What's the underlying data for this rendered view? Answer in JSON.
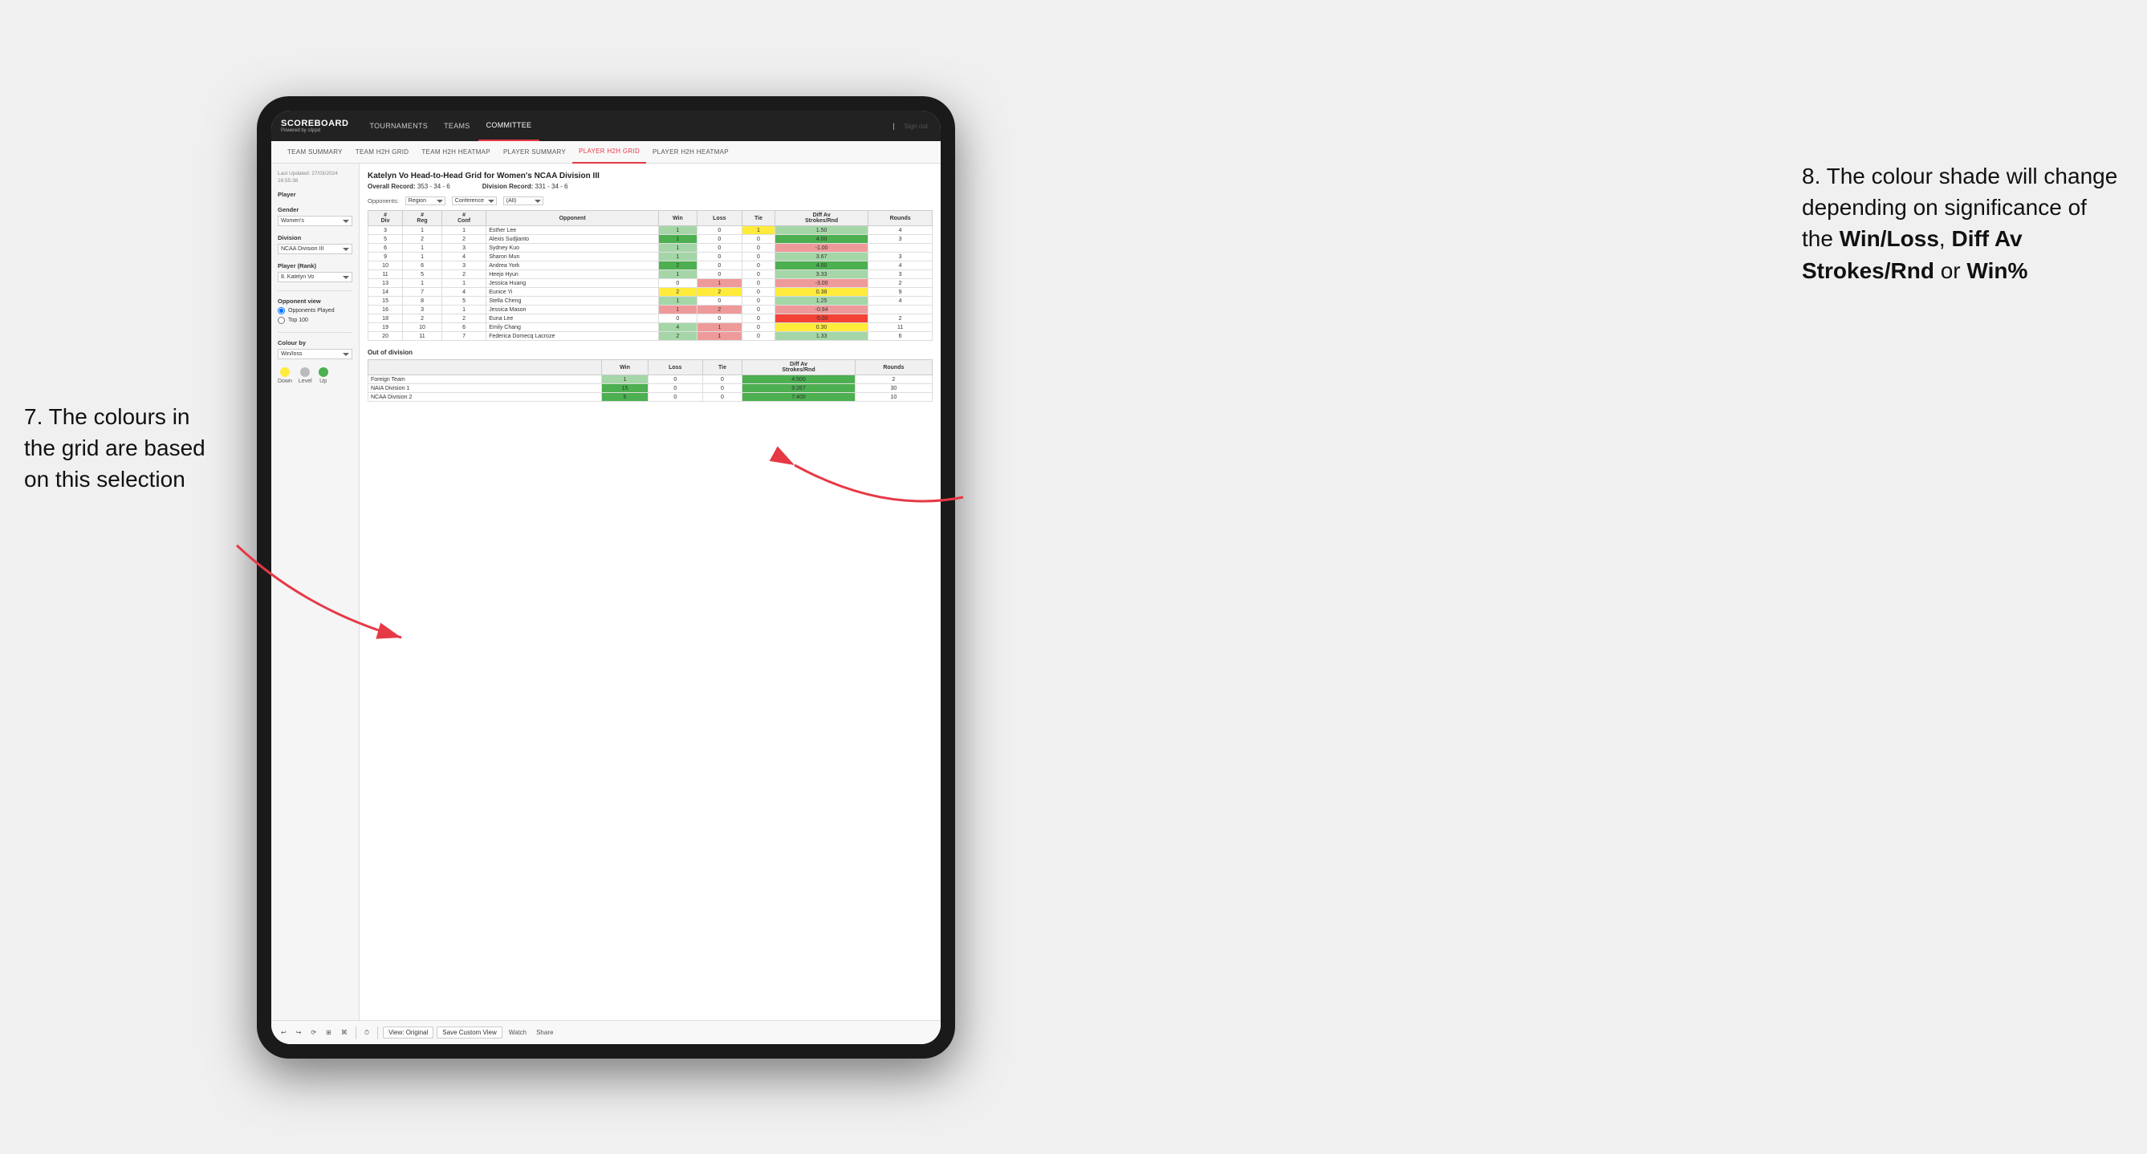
{
  "annotation_left": {
    "line1": "7. The colours in",
    "line2": "the grid are based",
    "line3": "on this selection"
  },
  "annotation_right": {
    "intro": "8. The colour shade will change depending on significance of the ",
    "bold1": "Win/Loss",
    "sep1": ", ",
    "bold2": "Diff Av Strokes/Rnd",
    "sep2": " or ",
    "bold3": "Win%"
  },
  "nav": {
    "logo": "SCOREBOARD",
    "logo_sub": "Powered by clippd",
    "links": [
      "TOURNAMENTS",
      "TEAMS",
      "COMMITTEE"
    ],
    "active_link": "COMMITTEE",
    "sign_in": "Sign out"
  },
  "sub_nav": {
    "links": [
      "TEAM SUMMARY",
      "TEAM H2H GRID",
      "TEAM H2H HEATMAP",
      "PLAYER SUMMARY",
      "PLAYER H2H GRID",
      "PLAYER H2H HEATMAP"
    ],
    "active": "PLAYER H2H GRID"
  },
  "sidebar": {
    "last_updated_label": "Last Updated: 27/03/2024 16:55:38",
    "player_label": "Player",
    "gender_label": "Gender",
    "gender_value": "Women's",
    "division_label": "Division",
    "division_value": "NCAA Division III",
    "player_rank_label": "Player (Rank)",
    "player_rank_value": "8. Katelyn Vo",
    "opponent_view_label": "Opponent view",
    "opponent_played": "Opponents Played",
    "top100": "Top 100",
    "colour_by_label": "Colour by",
    "colour_by_value": "Win/loss",
    "legend": {
      "down_label": "Down",
      "level_label": "Level",
      "up_label": "Up"
    }
  },
  "grid": {
    "title": "Katelyn Vo Head-to-Head Grid for Women's NCAA Division III",
    "overall_record_label": "Overall Record:",
    "overall_record": "353 - 34 - 6",
    "division_record_label": "Division Record:",
    "division_record": "331 - 34 - 6",
    "filter_opponents_label": "Opponents:",
    "filter_region_label": "Region",
    "filter_conference_label": "Conference",
    "filter_opponent_label": "Opponent",
    "filter_all": "(All)",
    "columns": {
      "div": "#\nDiv",
      "reg": "#\nReg",
      "conf": "#\nConf",
      "opponent": "Opponent",
      "win": "Win",
      "loss": "Loss",
      "tie": "Tie",
      "diff_av": "Diff Av\nStrokes/Rnd",
      "rounds": "Rounds"
    },
    "rows": [
      {
        "div": 3,
        "reg": 1,
        "conf": 1,
        "opponent": "Esther Lee",
        "win": 1,
        "loss": 0,
        "tie": 1,
        "diff": "1.50",
        "rounds": 4,
        "win_cls": "td-green-light",
        "loss_cls": "td-empty",
        "tie_cls": "td-yellow",
        "diff_cls": "td-green-light"
      },
      {
        "div": 5,
        "reg": 2,
        "conf": 2,
        "opponent": "Alexis Sudjianto",
        "win": 1,
        "loss": 0,
        "tie": 0,
        "diff": "4.00",
        "rounds": 3,
        "win_cls": "td-green-dark",
        "loss_cls": "td-empty",
        "tie_cls": "td-empty",
        "diff_cls": "td-green-dark"
      },
      {
        "div": 6,
        "reg": 1,
        "conf": 3,
        "opponent": "Sydney Kuo",
        "win": 1,
        "loss": 0,
        "tie": 0,
        "diff": "-1.00",
        "rounds": "",
        "win_cls": "td-green-light",
        "loss_cls": "td-empty",
        "tie_cls": "td-empty",
        "diff_cls": "td-red-light"
      },
      {
        "div": 9,
        "reg": 1,
        "conf": 4,
        "opponent": "Sharon Mun",
        "win": 1,
        "loss": 0,
        "tie": 0,
        "diff": "3.67",
        "rounds": 3,
        "win_cls": "td-green-light",
        "loss_cls": "td-empty",
        "tie_cls": "td-empty",
        "diff_cls": "td-green-light"
      },
      {
        "div": 10,
        "reg": 6,
        "conf": 3,
        "opponent": "Andrea York",
        "win": 2,
        "loss": 0,
        "tie": 0,
        "diff": "4.00",
        "rounds": 4,
        "win_cls": "td-green-dark",
        "loss_cls": "td-empty",
        "tie_cls": "td-empty",
        "diff_cls": "td-green-dark"
      },
      {
        "div": 11,
        "reg": 5,
        "conf": 2,
        "opponent": "Heejo Hyun",
        "win": 1,
        "loss": 0,
        "tie": 0,
        "diff": "3.33",
        "rounds": 3,
        "win_cls": "td-green-light",
        "loss_cls": "td-empty",
        "tie_cls": "td-empty",
        "diff_cls": "td-green-light"
      },
      {
        "div": 13,
        "reg": 1,
        "conf": 1,
        "opponent": "Jessica Huang",
        "win": 0,
        "loss": 1,
        "tie": 0,
        "diff": "-3.00",
        "rounds": 2,
        "win_cls": "td-empty",
        "loss_cls": "td-red-light",
        "tie_cls": "td-empty",
        "diff_cls": "td-red-light"
      },
      {
        "div": 14,
        "reg": 7,
        "conf": 4,
        "opponent": "Eunice Yi",
        "win": 2,
        "loss": 2,
        "tie": 0,
        "diff": "0.38",
        "rounds": 9,
        "win_cls": "td-yellow",
        "loss_cls": "td-yellow",
        "tie_cls": "td-empty",
        "diff_cls": "td-yellow"
      },
      {
        "div": 15,
        "reg": 8,
        "conf": 5,
        "opponent": "Stella Cheng",
        "win": 1,
        "loss": 0,
        "tie": 0,
        "diff": "1.25",
        "rounds": 4,
        "win_cls": "td-green-light",
        "loss_cls": "td-empty",
        "tie_cls": "td-empty",
        "diff_cls": "td-green-light"
      },
      {
        "div": 16,
        "reg": 3,
        "conf": 1,
        "opponent": "Jessica Mason",
        "win": 1,
        "loss": 2,
        "tie": 0,
        "diff": "-0.94",
        "rounds": "",
        "win_cls": "td-red-light",
        "loss_cls": "td-red-light",
        "tie_cls": "td-empty",
        "diff_cls": "td-red-light"
      },
      {
        "div": 18,
        "reg": 2,
        "conf": 2,
        "opponent": "Euna Lee",
        "win": 0,
        "loss": 0,
        "tie": 0,
        "diff": "-5.00",
        "rounds": 2,
        "win_cls": "td-empty",
        "loss_cls": "td-empty",
        "tie_cls": "td-empty",
        "diff_cls": "td-red-dark"
      },
      {
        "div": 19,
        "reg": 10,
        "conf": 6,
        "opponent": "Emily Chang",
        "win": 4,
        "loss": 1,
        "tie": 0,
        "diff": "0.30",
        "rounds": 11,
        "win_cls": "td-green-light",
        "loss_cls": "td-red-light",
        "tie_cls": "td-empty",
        "diff_cls": "td-yellow"
      },
      {
        "div": 20,
        "reg": 11,
        "conf": 7,
        "opponent": "Federica Domecq Lacroze",
        "win": 2,
        "loss": 1,
        "tie": 0,
        "diff": "1.33",
        "rounds": 6,
        "win_cls": "td-green-light",
        "loss_cls": "td-red-light",
        "tie_cls": "td-empty",
        "diff_cls": "td-green-light"
      }
    ],
    "out_of_division_label": "Out of division",
    "out_of_division_rows": [
      {
        "name": "Foreign Team",
        "win": 1,
        "loss": 0,
        "tie": 0,
        "diff": "4.500",
        "rounds": 2,
        "win_cls": "td-green-light",
        "diff_cls": "td-green-dark"
      },
      {
        "name": "NAIA Division 1",
        "win": 15,
        "loss": 0,
        "tie": 0,
        "diff": "9.267",
        "rounds": 30,
        "win_cls": "td-green-dark",
        "diff_cls": "td-green-dark"
      },
      {
        "name": "NCAA Division 2",
        "win": 5,
        "loss": 0,
        "tie": 0,
        "diff": "7.400",
        "rounds": 10,
        "win_cls": "td-green-dark",
        "diff_cls": "td-green-dark"
      }
    ]
  },
  "toolbar": {
    "view_original": "View: Original",
    "save_custom_view": "Save Custom View",
    "watch": "Watch",
    "share": "Share"
  }
}
